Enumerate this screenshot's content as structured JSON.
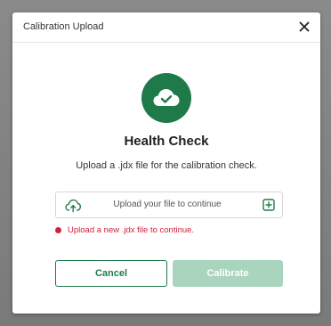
{
  "dialog": {
    "title": "Calibration Upload",
    "close_symbol": "✕"
  },
  "main": {
    "heading": "Health Check",
    "subtext": "Upload a .jdx file for the calibration check.",
    "status_icon": "cloud-check-icon"
  },
  "upload": {
    "label": "Upload your file to continue",
    "left_icon": "cloud-upload-icon",
    "right_icon": "plus-square-icon"
  },
  "error": {
    "message": "Upload a new .jdx file to continue."
  },
  "buttons": {
    "cancel_label": "Cancel",
    "calibrate_label": "Calibrate"
  },
  "colors": {
    "accent": "#1f7a4a",
    "disabled_accent": "#a9d4bd",
    "error": "#d0213a"
  }
}
